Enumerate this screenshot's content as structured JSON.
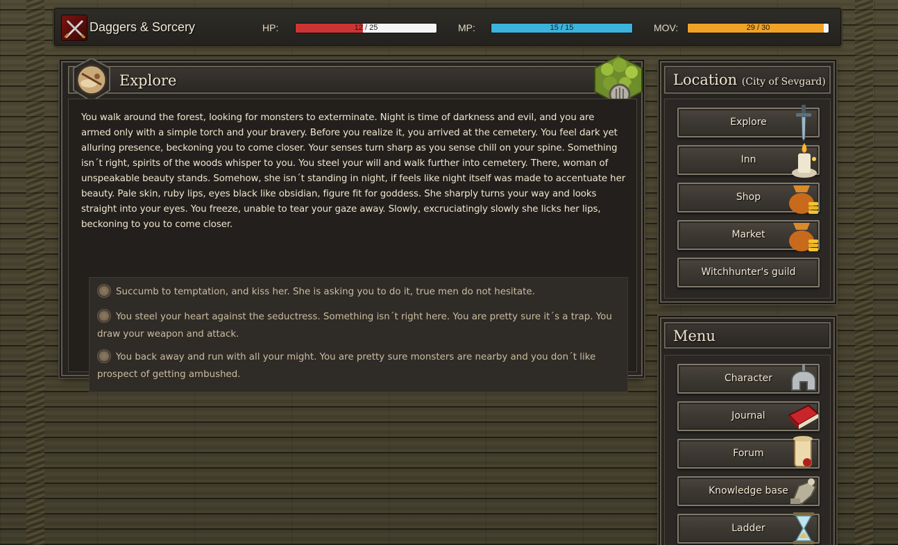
{
  "app": {
    "title": "Daggers & Sorcery"
  },
  "stats": {
    "hp": {
      "label": "HP:",
      "text": "12 / 25",
      "current": 12,
      "max": 25,
      "color": "#cc3434"
    },
    "mp": {
      "label": "MP:",
      "text": "15 / 15",
      "current": 15,
      "max": 15,
      "color": "#3bb3dd"
    },
    "mov": {
      "label": "MOV:",
      "text": "29 / 30",
      "current": 29,
      "max": 30,
      "color": "#f0a227"
    }
  },
  "explore": {
    "title": "Explore",
    "story": "You walk around the forest, looking for monsters to exterminate. Night is time of darkness and evil, and you are armed only with a simple torch and your bravery. Before you realize it, you arrived at the cemetery. You feel dark yet alluring presence, beckoning you to come closer. Your senses turn sharp as you sense chill on your spine. Something isn´t right, spirits of the woods whisper to you. You steel your will and walk further into cemetery. There, woman of unspeakable beauty stands. Somehow, she isn´t standing in night, if feels like night itself was made to accentuate her beauty. Pale skin, ruby lips, eyes black like obsidian, figure fit for goddess. She sharply turns your way and looks straight into your eyes. You freeze, unable to tear your gaze away. Slowly, excruciatingly slowly she licks her lips, beckoning to you to come closer.",
    "choices": [
      "Succumb to temptation, and kiss her. She is asking you to do it, true men do not hesitate.",
      "You steel your heart against the seductress. Something isn´t right here. You are pretty sure it´s a trap. You draw your weapon and attack.",
      "You back away and run with all your might. You are pretty sure monsters are nearby and you don´t like prospect of getting ambushed."
    ]
  },
  "location": {
    "title": "Location",
    "place": "(City of Sevgard)",
    "items": [
      {
        "label": "Explore",
        "icon": "sword-icon"
      },
      {
        "label": "Inn",
        "icon": "candle-icon"
      },
      {
        "label": "Shop",
        "icon": "gold-bag-icon"
      },
      {
        "label": "Market",
        "icon": "gold-bag-icon"
      },
      {
        "label": "Witchhunter's guild",
        "icon": ""
      }
    ]
  },
  "menu": {
    "title": "Menu",
    "items": [
      {
        "label": "Character",
        "icon": "helmet-icon"
      },
      {
        "label": "Journal",
        "icon": "book-icon"
      },
      {
        "label": "Forum",
        "icon": "scroll-icon"
      },
      {
        "label": "Knowledge base",
        "icon": "gauntlet-icon"
      },
      {
        "label": "Ladder",
        "icon": "hourglass-icon"
      }
    ]
  }
}
